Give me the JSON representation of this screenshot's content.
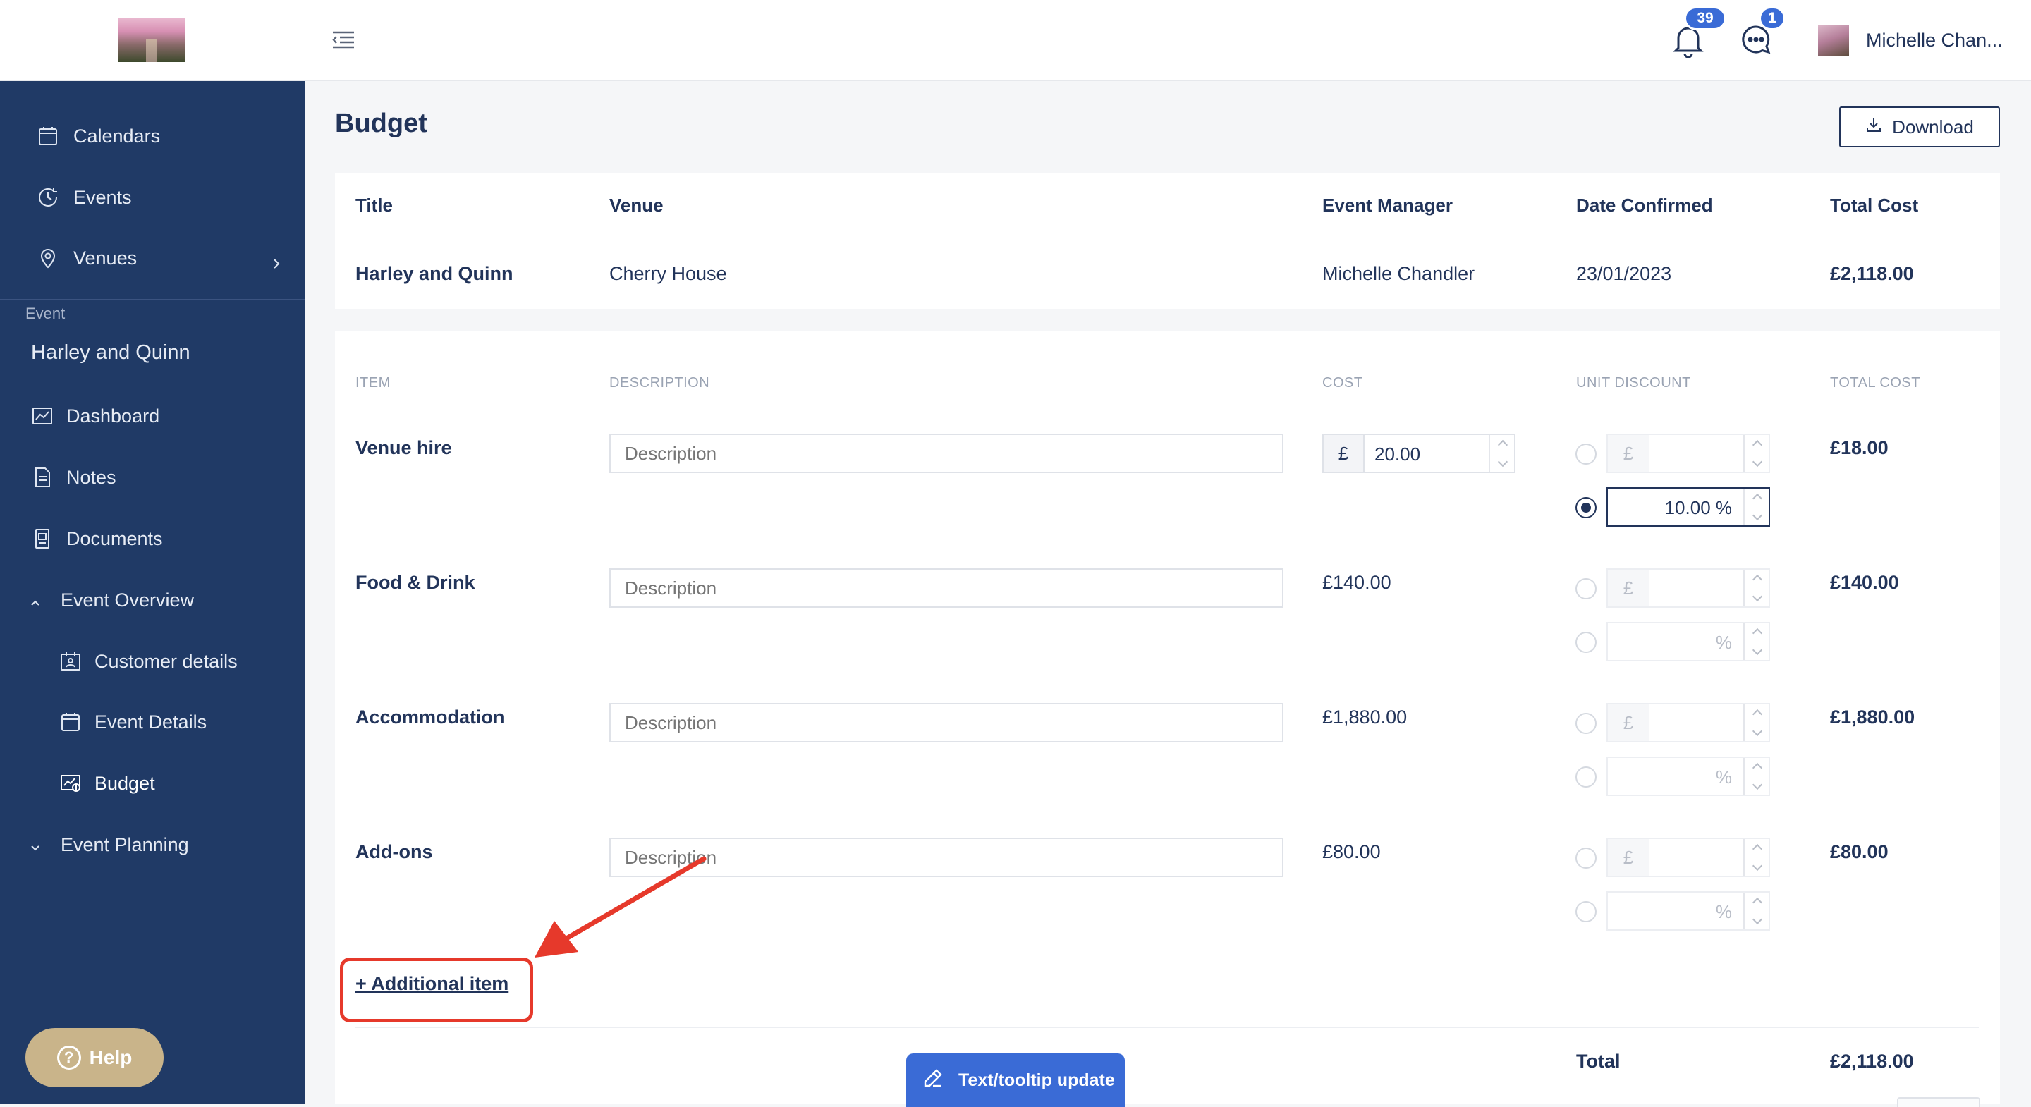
{
  "sidebar": {
    "nav": [
      {
        "label": "Calendars",
        "icon": "calendar-icon"
      },
      {
        "label": "Events",
        "icon": "clock-icon"
      },
      {
        "label": "Venues",
        "icon": "location-pin-icon"
      }
    ],
    "section_label": "Event",
    "event_name": "Harley and Quinn",
    "event_nav": [
      {
        "label": "Dashboard",
        "icon": "chart-icon"
      },
      {
        "label": "Notes",
        "icon": "notes-icon"
      },
      {
        "label": "Documents",
        "icon": "documents-icon"
      },
      {
        "label": "Event Overview",
        "icon": "chevron-up-icon"
      },
      {
        "label": "Customer details",
        "icon": "contact-card-icon"
      },
      {
        "label": "Event Details",
        "icon": "calendar-icon"
      },
      {
        "label": "Budget",
        "icon": "budget-icon"
      },
      {
        "label": "Event Planning",
        "icon": "chevron-down-icon"
      }
    ],
    "help_label": "Help"
  },
  "topbar": {
    "notifications_count": "39",
    "messages_count": "1",
    "user_name": "Michelle Chan..."
  },
  "page": {
    "title": "Budget",
    "download_label": "Download"
  },
  "summary": {
    "headers": {
      "title": "Title",
      "venue": "Venue",
      "manager": "Event Manager",
      "date": "Date Confirmed",
      "total": "Total Cost"
    },
    "row": {
      "title": "Harley and Quinn",
      "venue": "Cherry House",
      "manager": "Michelle Chandler",
      "date": "23/01/2023",
      "total": "£2,118.00"
    }
  },
  "budget": {
    "headers": {
      "item": "ITEM",
      "description": "DESCRIPTION",
      "cost": "COST",
      "discount": "UNIT DISCOUNT",
      "total": "TOTAL COST"
    },
    "description_placeholder": "Description",
    "currency_symbol": "£",
    "percent_symbol": "%",
    "items": [
      {
        "name": "Venue hire",
        "cost_value": "20.00",
        "discount_pct": "10.00 %",
        "total": "£18.00"
      },
      {
        "name": "Food & Drink",
        "cost": "£140.00",
        "total": "£140.00"
      },
      {
        "name": "Accommodation",
        "cost": "£1,880.00",
        "total": "£1,880.00"
      },
      {
        "name": "Add-ons",
        "cost": "£80.00",
        "total": "£80.00"
      }
    ],
    "add_item_label": "+ Additional item",
    "total_label": "Total",
    "total_value": "£2,118.00"
  },
  "tooltip_update_label": "Text/tooltip update",
  "colors": {
    "sidebar": "#203a66",
    "accent": "#3a6bd6",
    "highlight": "#e6392b",
    "help": "#c9b48a"
  }
}
